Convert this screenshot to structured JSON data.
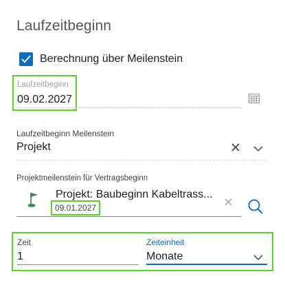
{
  "title": "Laufzeitbeginn",
  "milestone_checkbox": {
    "label": "Berechnung über Meilenstein",
    "checked": true
  },
  "laufzeitbeginn": {
    "label": "Laufzeitbeginn",
    "value": "09.02.2027",
    "icon": "calendar-icon"
  },
  "laufzeitbeginn_meilenstein": {
    "label": "Laufzeitbeginn Meilenstein",
    "value": "Projekt",
    "clear_icon": "close-icon",
    "dropdown_icon": "chevron-down-icon"
  },
  "projektmeilenstein": {
    "label": "Projektmeilenstein für Vertragsbeginn",
    "name": "Projekt: Baubeginn Kabeltrass...",
    "date": "09.01.2027",
    "icon": "milestone-flag-icon",
    "clear_icon": "close-icon",
    "search_icon": "search-icon"
  },
  "zeit": {
    "label": "Zeit",
    "value": "1"
  },
  "zeiteinheit": {
    "label": "Zeiteinheit",
    "value": "Monate",
    "dropdown_icon": "chevron-down-icon"
  },
  "colors": {
    "accent": "#0f6cbd",
    "highlight": "#5bd32c"
  }
}
